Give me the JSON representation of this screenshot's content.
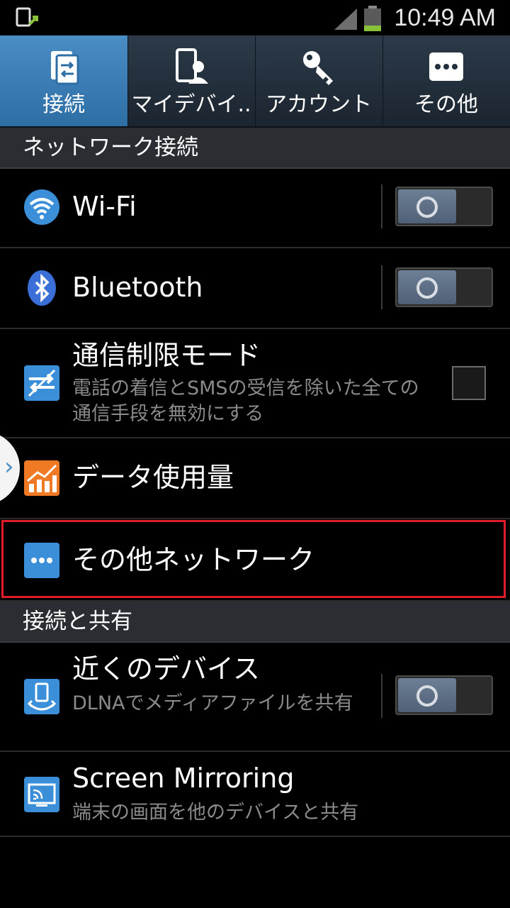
{
  "status_bar": {
    "time": "10:49 AM",
    "icons": [
      "notification-icon",
      "signal-icon",
      "battery-icon"
    ]
  },
  "tabs": [
    {
      "label": "接続",
      "icon": "connections-icon",
      "active": true
    },
    {
      "label": "マイデバイ..",
      "icon": "my-device-icon",
      "active": false
    },
    {
      "label": "アカウント",
      "icon": "accounts-icon",
      "active": false
    },
    {
      "label": "その他",
      "icon": "more-icon",
      "active": false
    }
  ],
  "sections": {
    "network": {
      "header": "ネットワーク接続"
    },
    "share": {
      "header": "接続と共有"
    }
  },
  "items": {
    "wifi": {
      "title": "Wi-Fi",
      "toggle": "off",
      "icon": "wifi-icon"
    },
    "bluetooth": {
      "title": "Bluetooth",
      "toggle": "off",
      "icon": "bluetooth-icon"
    },
    "flight_mode": {
      "title": "通信制限モード",
      "subtitle": "電話の着信とSMSの受信を除いた全ての通信手段を無効にする",
      "checked": false,
      "icon": "flight-mode-icon"
    },
    "data_usage": {
      "title": "データ使用量",
      "icon": "data-usage-icon"
    },
    "more_networks": {
      "title": "その他ネットワーク",
      "icon": "more-networks-icon",
      "highlighted": true
    },
    "nearby_devices": {
      "title": "近くのデバイス",
      "subtitle": "DLNAでメディアファイルを共有",
      "toggle": "off",
      "icon": "nearby-devices-icon"
    },
    "screen_mirroring": {
      "title": "Screen Mirroring",
      "subtitle": "端末の画面を他のデバイスと共有",
      "icon": "screen-mirroring-icon"
    }
  },
  "colors": {
    "accent": "#2d6ea5",
    "highlight_border": "#e01c2a",
    "background": "#000000"
  }
}
